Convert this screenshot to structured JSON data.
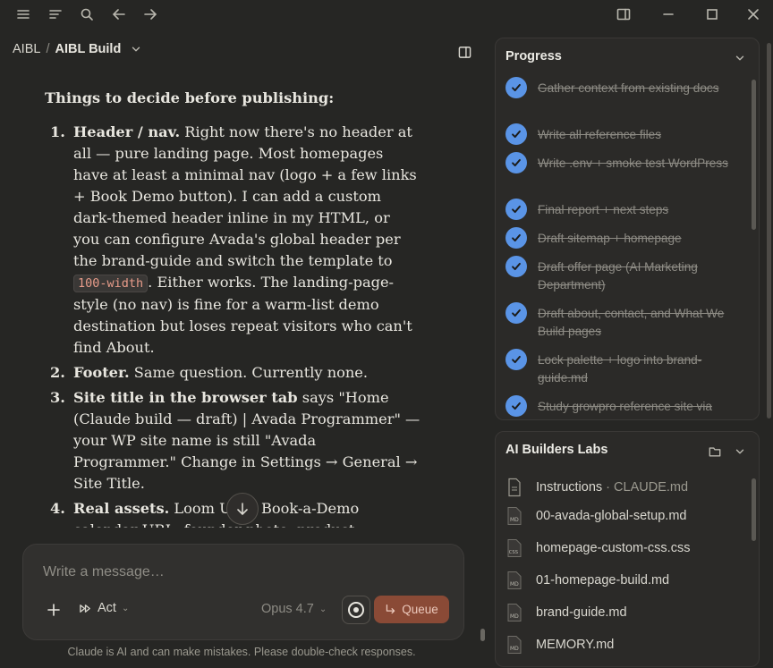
{
  "breadcrumb": {
    "project": "AIBL",
    "separator": "/",
    "current": "AIBL Build"
  },
  "content": {
    "heading": "Things to decide before publishing:",
    "items": [
      {
        "num": "1.",
        "bold": "Header / nav.",
        "text_before": " Right now there's no header at all — pure landing page. Most homepages have at least a minimal nav (logo + a few links + Book Demo button). I can add a custom dark-themed header inline in my HTML, or you can configure Avada's global header per the brand-guide and switch the template to ",
        "code": "100-width",
        "text_after": ". Either works. The landing-page-style (no nav) is fine for a warm-list demo destination but loses repeat visitors who can't find About."
      },
      {
        "num": "2.",
        "bold": "Footer.",
        "text": " Same question. Currently none."
      },
      {
        "num": "3.",
        "bold": "Site title in the browser tab",
        "text": " says \"Home (Claude build — draft) | Avada Programmer\" — your WP site name is still \"Avada Programmer.\" Change in Settings → General → Site Title."
      },
      {
        "num": "4.",
        "bold": "Real assets.",
        "text": " Loom URL, Book-a-Demo calendar URL, founder photo, product screenshot — drop those in when ready and I'll find/replace."
      }
    ]
  },
  "composer": {
    "placeholder": "Write a message…",
    "mode_label": "Act",
    "model_label": "Opus 4.7",
    "queue_label": "Queue"
  },
  "disclaimer": "Claude is AI and can make mistakes. Please double-check responses.",
  "progress": {
    "title": "Progress",
    "tasks": [
      {
        "label": "Gather context from existing docs",
        "done": true
      },
      {
        "label": "Write all reference files",
        "done": true
      },
      {
        "label": "Write .env + smoke test WordPress",
        "done": true
      },
      {
        "label": "Final report + next steps",
        "done": true
      },
      {
        "label": "Draft sitemap + homepage",
        "done": true
      },
      {
        "label": "Draft offer page (AI Marketing Department)",
        "done": true
      },
      {
        "label": "Draft about, contact, and What We Build pages",
        "done": true
      },
      {
        "label": "Lock palette + logo into brand-guide.md",
        "done": true
      },
      {
        "label": "Study growpro reference site via Chrome MCP",
        "done": true
      }
    ]
  },
  "files": {
    "title": "AI Builders Labs",
    "items": [
      {
        "name": "Instructions",
        "sub": " · CLAUDE.md",
        "icon": "document-icon"
      },
      {
        "name": "00-avada-global-setup.md",
        "sub": "",
        "icon": "md-file-icon"
      },
      {
        "name": "homepage-custom-css.css",
        "sub": "",
        "icon": "css-file-icon"
      },
      {
        "name": "01-homepage-build.md",
        "sub": "",
        "icon": "md-file-icon"
      },
      {
        "name": "brand-guide.md",
        "sub": "",
        "icon": "md-file-icon"
      },
      {
        "name": "MEMORY.md",
        "sub": "",
        "icon": "md-file-icon"
      }
    ]
  }
}
